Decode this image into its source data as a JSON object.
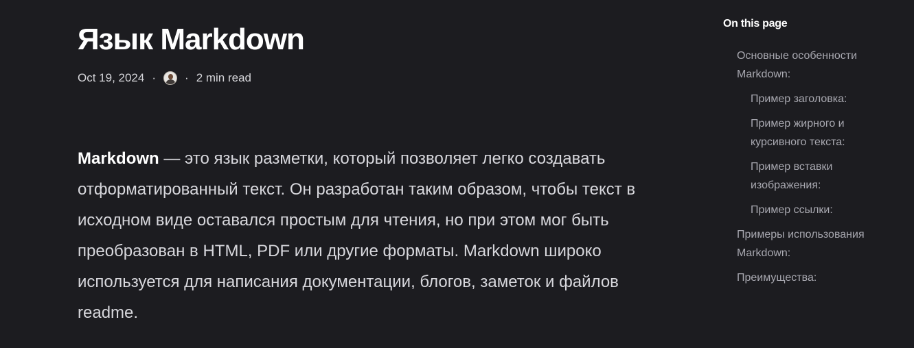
{
  "article": {
    "title": "Язык Markdown",
    "date": "Oct 19, 2024",
    "separator": "·",
    "read_time": "2 min read",
    "intro_bold": "Markdown",
    "intro_rest": " — это язык разметки, который позволяет легко создавать отформатированный текст. Он разработан таким образом, чтобы текст в исходном виде оставался простым для чтения, но при этом мог быть преобразован в HTML, PDF или другие форматы. Markdown широко используется для написания документации, блогов, заметок и файлов readme."
  },
  "toc": {
    "title": "On this page",
    "items": [
      {
        "label": "Основные особенности Markdown:",
        "level": 1
      },
      {
        "label": "Пример заголовка:",
        "level": 2
      },
      {
        "label": "Пример жирного и курсивного текста:",
        "level": 2
      },
      {
        "label": "Пример вставки изображения:",
        "level": 2
      },
      {
        "label": "Пример ссылки:",
        "level": 2
      },
      {
        "label": "Примеры использования Markdown:",
        "level": 1
      },
      {
        "label": "Преимущества:",
        "level": 1
      }
    ]
  },
  "colors": {
    "background": "#1c1c20",
    "heading": "#ffffff",
    "body_text": "#d7d7dc",
    "toc_link": "#a8a8b0"
  },
  "icons": {
    "author_avatar": "author-avatar"
  }
}
